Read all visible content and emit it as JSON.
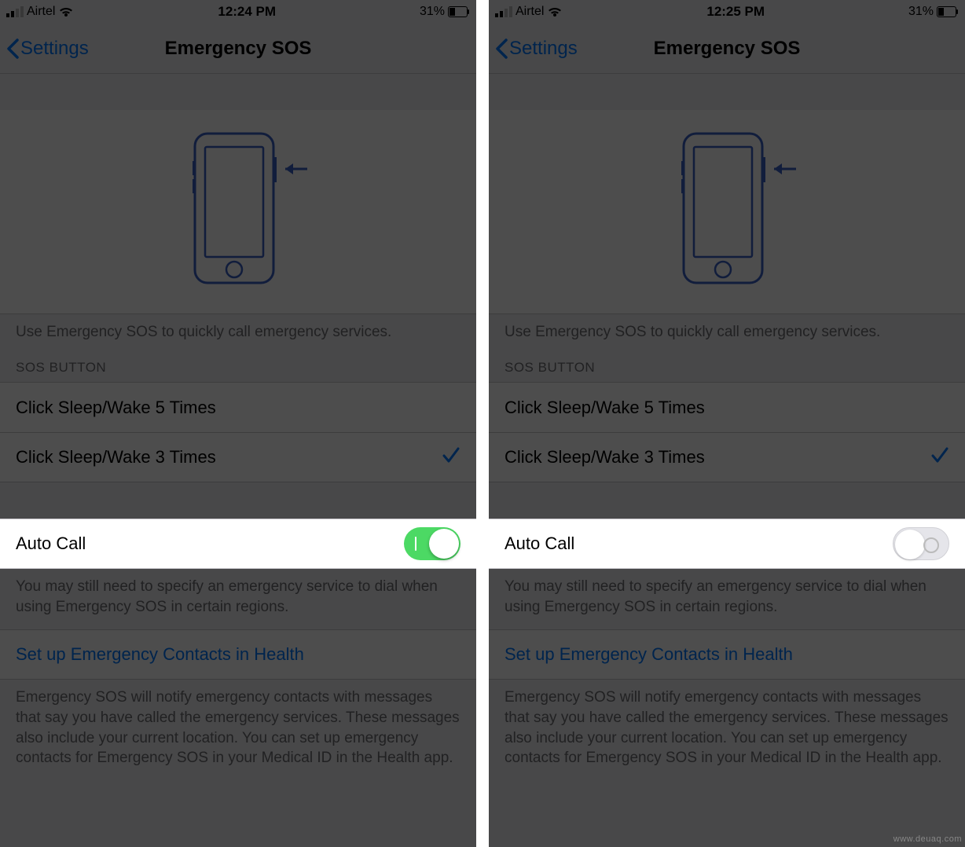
{
  "watermark": "www.deuaq.com",
  "screens": {
    "left": {
      "status": {
        "carrier": "Airtel",
        "time": "12:24 PM",
        "battery_pct": "31%"
      },
      "nav": {
        "back_label": "Settings",
        "title": "Emergency SOS"
      },
      "caption1": "Use Emergency SOS to quickly call emergency services.",
      "section_header": "SOS BUTTON",
      "options": [
        {
          "label": "Click Sleep/Wake 5 Times",
          "selected": false
        },
        {
          "label": "Click Sleep/Wake 3 Times",
          "selected": true
        }
      ],
      "auto_call": {
        "label": "Auto Call",
        "on": true
      },
      "footer1": "You may still need to specify an emergency service to dial when using Emergency SOS in certain regions.",
      "link": "Set up Emergency Contacts in Health",
      "footer2": "Emergency SOS will notify emergency contacts with messages that say you have called the emergency services. These messages also include your current location. You can set up emergency contacts for Emergency SOS in your Medical ID in the Health app."
    },
    "right": {
      "status": {
        "carrier": "Airtel",
        "time": "12:25 PM",
        "battery_pct": "31%"
      },
      "nav": {
        "back_label": "Settings",
        "title": "Emergency SOS"
      },
      "caption1": "Use Emergency SOS to quickly call emergency services.",
      "section_header": "SOS BUTTON",
      "options": [
        {
          "label": "Click Sleep/Wake 5 Times",
          "selected": false
        },
        {
          "label": "Click Sleep/Wake 3 Times",
          "selected": true
        }
      ],
      "auto_call": {
        "label": "Auto Call",
        "on": false
      },
      "footer1": "You may still need to specify an emergency service to dial when using Emergency SOS in certain regions.",
      "link": "Set up Emergency Contacts in Health",
      "footer2": "Emergency SOS will notify emergency contacts with messages that say you have called the emergency services. These messages also include your current location. You can set up emergency contacts for Emergency SOS in your Medical ID in the Health app."
    }
  }
}
